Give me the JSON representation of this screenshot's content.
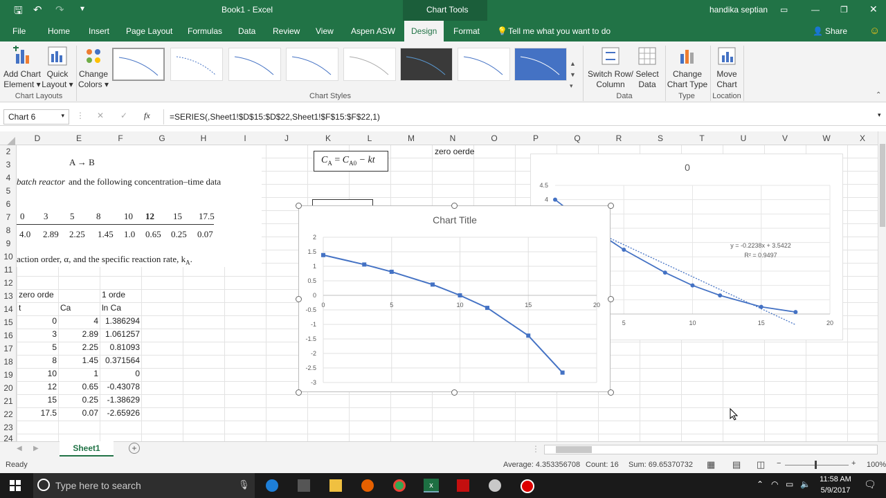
{
  "titlebar": {
    "doc_title": "Book1 - Excel",
    "context_title": "Chart Tools",
    "user": "handika septian"
  },
  "tabs": [
    "File",
    "Home",
    "Insert",
    "Page Layout",
    "Formulas",
    "Data",
    "Review",
    "View",
    "Aspen ASW",
    "Design",
    "Format"
  ],
  "tellme": "Tell me what you want to do",
  "share": "Share",
  "ribbon": {
    "add_chart_element": [
      "Add Chart",
      "Element"
    ],
    "quick_layout": [
      "Quick",
      "Layout"
    ],
    "change_colors": [
      "Change",
      "Colors"
    ],
    "switch_row_col": [
      "Switch Row/",
      "Column"
    ],
    "select_data": [
      "Select",
      "Data"
    ],
    "change_type": [
      "Change",
      "Chart Type"
    ],
    "move_chart": [
      "Move",
      "Chart"
    ],
    "groups": {
      "layouts": "Chart Layouts",
      "styles": "Chart Styles",
      "data": "Data",
      "type": "Type",
      "location": "Location"
    }
  },
  "formula_bar": {
    "name_box": "Chart 6",
    "formula": "=SERIES(,Sheet1!$D$15:$D$22,Sheet1!$F$15:$F$22,1)",
    "fx": "fx"
  },
  "columns": [
    "D",
    "E",
    "F",
    "G",
    "H",
    "I",
    "J",
    "K",
    "L",
    "M",
    "N",
    "O",
    "P",
    "Q",
    "R",
    "S",
    "T",
    "U",
    "V",
    "W",
    "X"
  ],
  "rows": [
    "2",
    "3",
    "4",
    "5",
    "6",
    "7",
    "8",
    "9",
    "10",
    "11",
    "12",
    "13",
    "14",
    "15",
    "16",
    "17",
    "18",
    "19",
    "20",
    "21",
    "22",
    "23",
    "24"
  ],
  "image_text": {
    "reaction": "A → B",
    "line1a": "batch reactor",
    "line1b": "and the following concentration–time data",
    "t_vals": [
      "0",
      "3",
      "5",
      "8",
      "10",
      "12",
      "15",
      "17.5"
    ],
    "c_vals": [
      "4.0",
      "2.89",
      "2.25",
      "1.45",
      "1.0",
      "0.65",
      "0.25",
      "0.07"
    ],
    "line2": "action order, α, and the specific reaction rate, k",
    "line2_sub": "A",
    "line2_end": "."
  },
  "equation": {
    "lhs": "C",
    "sub_a": "A",
    "eq": " = ",
    "c": "C",
    "sub_a0": "A0",
    "rest": " − kt"
  },
  "cells": {
    "zero_orde": "zero orde",
    "satu_orde": "1 orde",
    "t": "t",
    "ca": "Ca",
    "lnca": "ln Ca",
    "zero_oerde": "zero oerde",
    "table": [
      [
        "0",
        "4",
        "1.386294"
      ],
      [
        "3",
        "2.89",
        "1.061257"
      ],
      [
        "5",
        "2.25",
        "0.81093"
      ],
      [
        "8",
        "1.45",
        "0.371564"
      ],
      [
        "10",
        "1",
        "0"
      ],
      [
        "12",
        "0.65",
        "-0.43078"
      ],
      [
        "15",
        "0.25",
        "-1.38629"
      ],
      [
        "17.5",
        "0.07",
        "-2.65926"
      ]
    ]
  },
  "chart_data": [
    {
      "type": "scatter",
      "title": "Chart Title",
      "x": [
        0,
        3,
        5,
        8,
        10,
        12,
        15,
        17.5
      ],
      "y": [
        1.386294,
        1.061257,
        0.81093,
        0.371564,
        0,
        -0.43078,
        -1.38629,
        -2.65926
      ],
      "xlim": [
        0,
        20
      ],
      "ylim": [
        -3,
        2
      ],
      "xticks": [
        "0",
        "5",
        "10",
        "15",
        "20"
      ],
      "yticks": [
        "2",
        "1.5",
        "1",
        "0.5",
        "0",
        "-0.5",
        "-1",
        "-1.5",
        "-2",
        "-2.5",
        "-3"
      ],
      "grid": true,
      "color": "#4472c4"
    },
    {
      "type": "scatter",
      "title": "0",
      "x": [
        0,
        3,
        5,
        8,
        10,
        12,
        15,
        17.5
      ],
      "y": [
        4,
        2.89,
        2.25,
        1.45,
        1,
        0.65,
        0.25,
        0.07
      ],
      "xlim": [
        0,
        20
      ],
      "ylim": [
        0,
        4.5
      ],
      "xticks": [
        "5",
        "10",
        "15",
        "20"
      ],
      "yticks": [
        "4.5",
        "4"
      ],
      "trendline": {
        "equation": "y = -0.2238x + 3.5422",
        "r2": "R² = 0.9497",
        "slope": -0.2238,
        "intercept": 3.5422
      },
      "grid": true,
      "color": "#4472c4"
    }
  ],
  "sheet": {
    "tab": "Sheet1"
  },
  "status": {
    "ready": "Ready",
    "average": "Average: 4.353356708",
    "count": "Count: 16",
    "sum": "Sum: 69.65370732",
    "zoom": "100%"
  },
  "taskbar": {
    "search": "Type here to search",
    "time": "11:58 AM",
    "date": "5/9/2017"
  }
}
